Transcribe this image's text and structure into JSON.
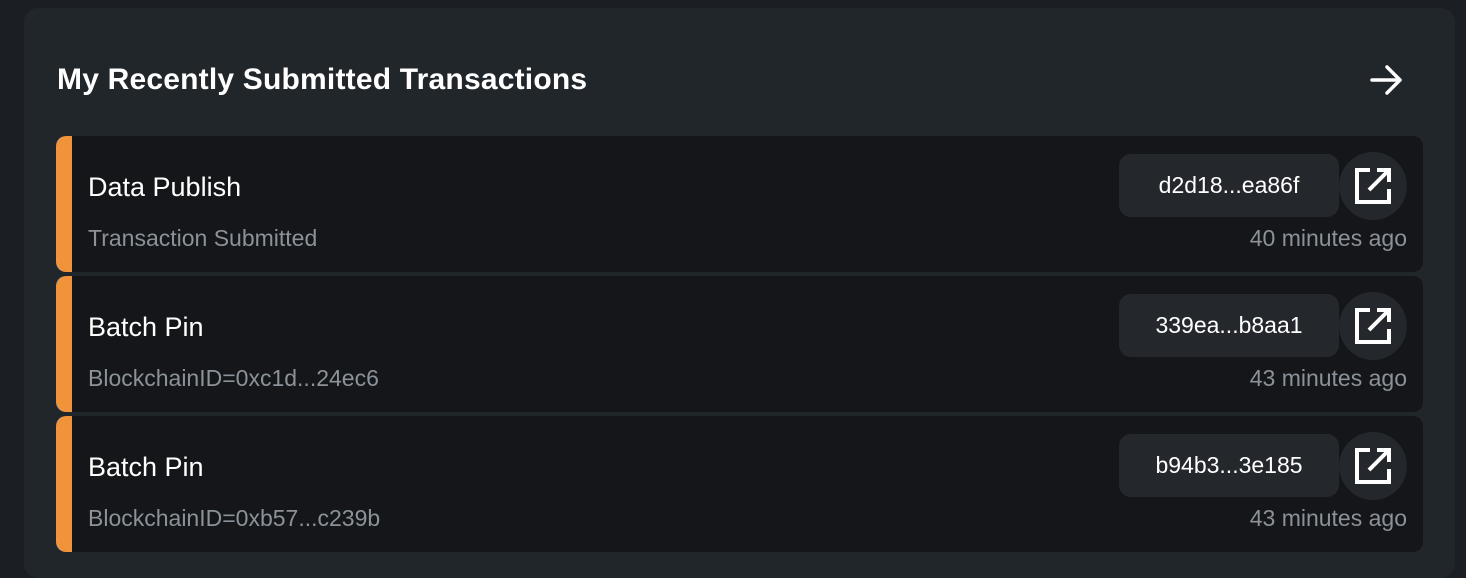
{
  "header": {
    "title": "My Recently Submitted Transactions",
    "arrow_icon": "arrow-right-icon"
  },
  "colors": {
    "panel_bg": "#21262a",
    "card_bg": "#141619",
    "accent": "#f0933a",
    "muted_text": "#8b9299"
  },
  "transactions": [
    {
      "name": "Data Publish",
      "subtitle": "Transaction Submitted",
      "hash": "d2d18...ea86f",
      "time": "40 minutes ago",
      "link_icon": "open-external-icon"
    },
    {
      "name": "Batch Pin",
      "subtitle": "BlockchainID=0xc1d...24ec6",
      "hash": "339ea...b8aa1",
      "time": "43 minutes ago",
      "link_icon": "open-external-icon"
    },
    {
      "name": "Batch Pin",
      "subtitle": "BlockchainID=0xb57...c239b",
      "hash": "b94b3...3e185",
      "time": "43 minutes ago",
      "link_icon": "open-external-icon"
    }
  ]
}
